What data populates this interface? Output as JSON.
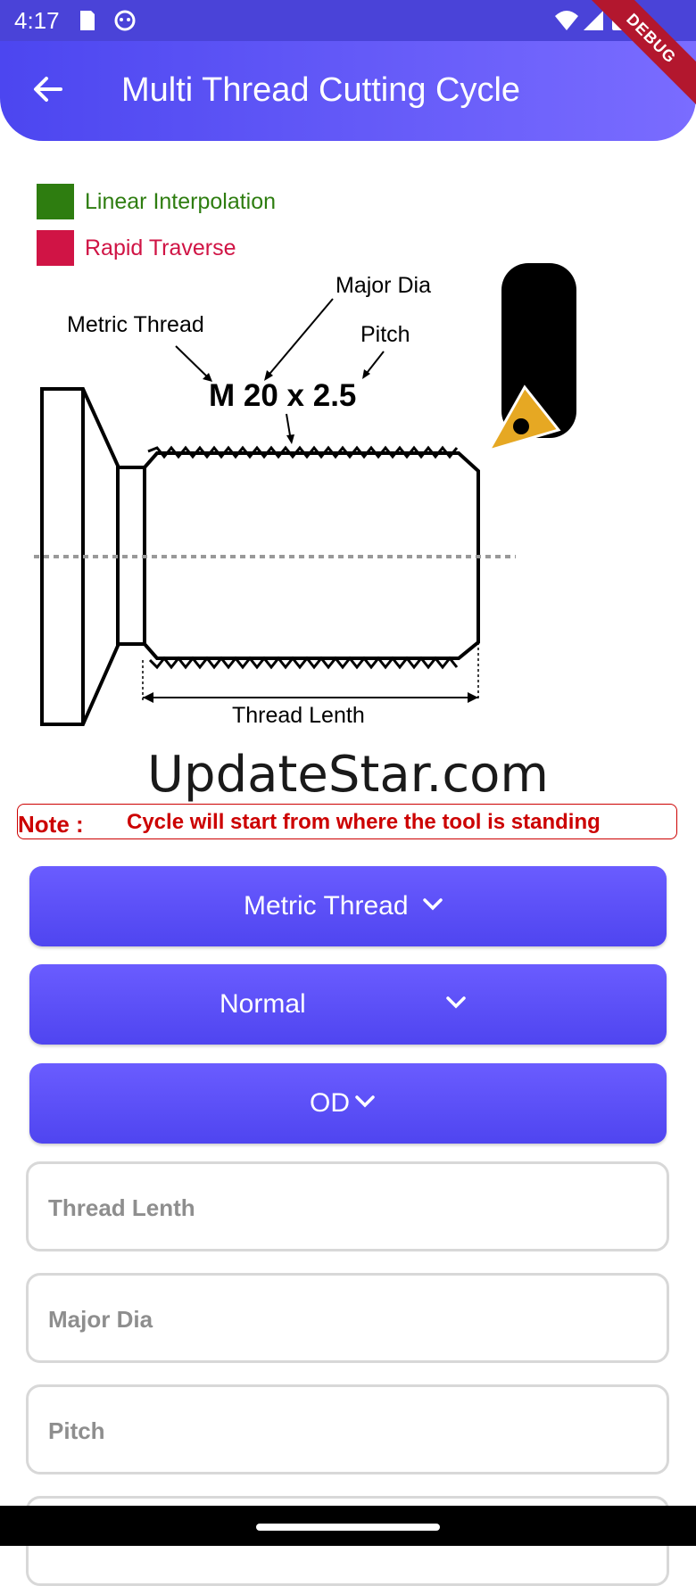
{
  "status_bar": {
    "time": "4:17"
  },
  "app_bar": {
    "title": "Multi Thread Cutting Cycle",
    "debug_label": "DEBUG"
  },
  "legend": [
    {
      "label": "Linear Interpolation",
      "color": "#2e7d10"
    },
    {
      "label": "Rapid Traverse",
      "color": "#d01445"
    }
  ],
  "diagram": {
    "metric_thread": "Metric Thread",
    "major_dia": "Major Dia",
    "pitch": "Pitch",
    "designation": "M 20 x 2.5",
    "thread_length": "Thread Lenth"
  },
  "watermark": "UpdateStar.com",
  "note": {
    "prefix": "Note :",
    "text": "Cycle will start from where the tool is standing"
  },
  "dropdowns": {
    "thread_type": "Metric Thread",
    "mode": "Normal",
    "side": "OD"
  },
  "inputs": {
    "thread_length_placeholder": "Thread Lenth",
    "major_dia_placeholder": "Major Dia",
    "pitch_placeholder": "Pitch"
  },
  "colors": {
    "accent": "#5a4ff5",
    "note_red": "#cc0000",
    "tool_insert": "#e6a823"
  }
}
